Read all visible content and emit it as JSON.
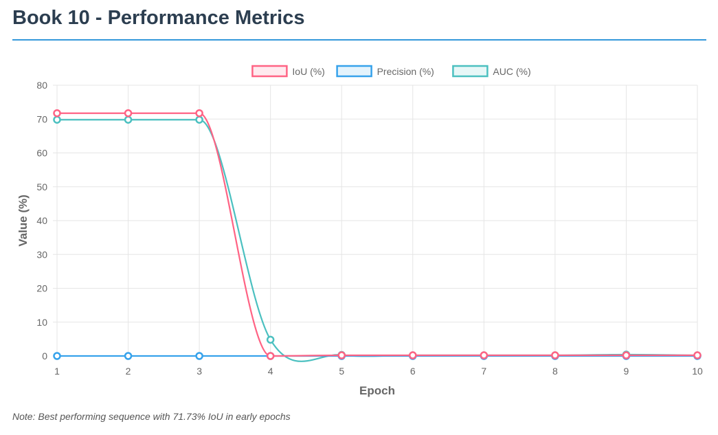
{
  "page": {
    "title": "Book 10 - Performance Metrics",
    "note": "Note: Best performing sequence with 71.73% IoU in early epochs",
    "accent_color": "#3498db",
    "title_color": "#2c3e50"
  },
  "chart_data": {
    "type": "line",
    "title": "",
    "xlabel": "Epoch",
    "ylabel": "Value (%)",
    "x": [
      1,
      2,
      3,
      4,
      5,
      6,
      7,
      8,
      9,
      10
    ],
    "ylim": [
      0,
      80
    ],
    "yticks": [
      0,
      10,
      20,
      30,
      40,
      50,
      60,
      70,
      80
    ],
    "grid": true,
    "legend_position": "top-center",
    "series": [
      {
        "name": "IoU (%)",
        "color": "#ff6384",
        "values": [
          71.73,
          71.73,
          71.73,
          0,
          0.2,
          0.2,
          0.2,
          0.2,
          0.2,
          0.2
        ]
      },
      {
        "name": "Precision (%)",
        "color": "#36a2eb",
        "values": [
          0,
          0,
          0,
          0,
          0,
          0,
          0,
          0,
          0,
          0
        ]
      },
      {
        "name": "AUC (%)",
        "color": "#4bc0c0",
        "values": [
          69.8,
          69.8,
          69.8,
          4.8,
          0.3,
          0.2,
          0.2,
          0.2,
          0.4,
          0.2
        ]
      }
    ]
  }
}
